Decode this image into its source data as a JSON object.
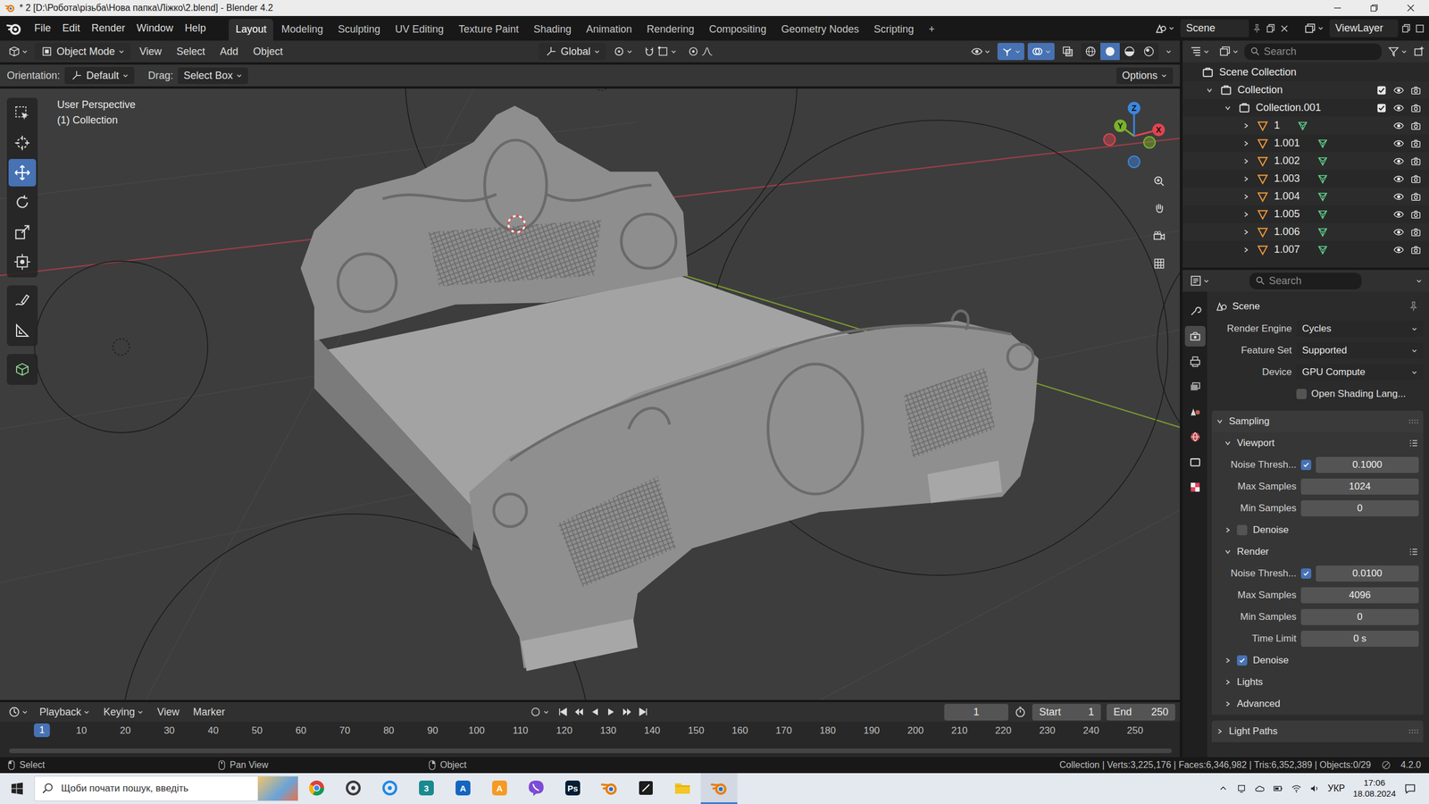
{
  "window": {
    "title": "* 2 [D:\\Робота\\різьба\\Нова папка\\Ліжко\\2.blend] - Blender 4.2"
  },
  "topbar": {
    "menus": [
      "File",
      "Edit",
      "Render",
      "Window",
      "Help"
    ],
    "workspaces": [
      {
        "label": "Layout",
        "selected": true
      },
      {
        "label": "Modeling",
        "selected": false
      },
      {
        "label": "Sculpting",
        "selected": false
      },
      {
        "label": "UV Editing",
        "selected": false
      },
      {
        "label": "Texture Paint",
        "selected": false
      },
      {
        "label": "Shading",
        "selected": false
      },
      {
        "label": "Animation",
        "selected": false
      },
      {
        "label": "Rendering",
        "selected": false
      },
      {
        "label": "Compositing",
        "selected": false
      },
      {
        "label": "Geometry Nodes",
        "selected": false
      },
      {
        "label": "Scripting",
        "selected": false
      }
    ],
    "add_tab": "+",
    "scene": "Scene",
    "view_layer": "ViewLayer"
  },
  "viewport": {
    "header": {
      "mode": "Object Mode",
      "menus": [
        "View",
        "Select",
        "Add",
        "Object"
      ],
      "orientation": "Global",
      "toggles": [
        {
          "kind": "visibility",
          "on": false
        },
        {
          "kind": "gizmos",
          "on": true
        },
        {
          "kind": "overlays",
          "on": true
        },
        {
          "kind": "xray",
          "on": false
        }
      ],
      "shading": [
        {
          "kind": "wireframe",
          "selected": false
        },
        {
          "kind": "solid",
          "selected": true
        },
        {
          "kind": "material",
          "selected": false
        },
        {
          "kind": "rendered",
          "selected": false
        }
      ]
    },
    "tool_settings": {
      "orientation_label": "Orientation:",
      "orientation": "Default",
      "drag_label": "Drag:",
      "drag": "Select Box",
      "options": "Options"
    },
    "overlay_text": [
      "User Perspective",
      "(1) Collection"
    ],
    "tool_groups": [
      [
        {
          "kind": "select",
          "selected": false
        },
        {
          "kind": "cursor",
          "selected": false
        },
        {
          "kind": "move",
          "selected": true
        },
        {
          "kind": "rotate",
          "selected": false
        },
        {
          "kind": "scale",
          "selected": false
        },
        {
          "kind": "transform",
          "selected": false
        }
      ],
      [
        {
          "kind": "annotate",
          "selected": false
        },
        {
          "kind": "measure",
          "selected": false
        }
      ],
      [
        {
          "kind": "add-cube",
          "selected": false
        }
      ]
    ],
    "gizmo_axes": [
      {
        "label": "X",
        "color": "#e0454f"
      },
      {
        "label": "Y",
        "color": "#7bb22a"
      },
      {
        "label": "Z",
        "color": "#3b86e0"
      }
    ]
  },
  "timeline": {
    "menus": [
      "Playback",
      "Keying",
      "View",
      "Marker"
    ],
    "current_frame": "1",
    "start_label": "Start",
    "start": "1",
    "end_label": "End",
    "end": "250",
    "playhead": "1",
    "ticks": [
      "10",
      "20",
      "30",
      "40",
      "50",
      "60",
      "70",
      "80",
      "90",
      "100",
      "110",
      "120",
      "130",
      "140",
      "150",
      "160",
      "170",
      "180",
      "190",
      "200",
      "210",
      "220",
      "230",
      "240",
      "250"
    ]
  },
  "status_bar": {
    "hints": [
      "Select",
      "Pan View",
      "Object"
    ],
    "stats": "Collection | Verts:3,225,176 | Faces:6,346,982 | Tris:6,352,389 | Objects:0/29",
    "version": "4.2.0"
  },
  "outliner": {
    "search": "Search",
    "tree": {
      "label": "Scene Collection",
      "kind": "scene",
      "expanded": true,
      "children": [
        {
          "label": "Collection",
          "kind": "collection",
          "expanded": true,
          "checked": true,
          "visible": true,
          "renderable": true,
          "children": [
            {
              "label": "Collection.001",
              "kind": "collection",
              "expanded": true,
              "checked": true,
              "visible": true,
              "renderable": true,
              "children": [
                {
                  "label": "1",
                  "kind": "object",
                  "expanded": false,
                  "visible": true,
                  "renderable": true
                },
                {
                  "label": "1.001",
                  "kind": "object",
                  "expanded": false,
                  "visible": true,
                  "renderable": true
                },
                {
                  "label": "1.002",
                  "kind": "object",
                  "expanded": false,
                  "visible": true,
                  "renderable": true
                },
                {
                  "label": "1.003",
                  "kind": "object",
                  "expanded": false,
                  "visible": true,
                  "renderable": true
                },
                {
                  "label": "1.004",
                  "kind": "object",
                  "expanded": false,
                  "visible": true,
                  "renderable": true
                },
                {
                  "label": "1.005",
                  "kind": "object",
                  "expanded": false,
                  "visible": true,
                  "renderable": true
                },
                {
                  "label": "1.006",
                  "kind": "object",
                  "expanded": false,
                  "visible": true,
                  "renderable": true
                },
                {
                  "label": "1.007",
                  "kind": "object",
                  "expanded": false,
                  "visible": true,
                  "renderable": true
                }
              ]
            }
          ]
        }
      ]
    }
  },
  "properties": {
    "search": "Search",
    "tabs": [
      {
        "kind": "tool",
        "selected": false
      },
      {
        "kind": "render",
        "selected": true
      },
      {
        "kind": "output",
        "selected": false
      },
      {
        "kind": "view-layer",
        "selected": false
      },
      {
        "kind": "scene",
        "selected": false
      },
      {
        "kind": "world",
        "selected": false
      },
      {
        "kind": "collection",
        "selected": false
      },
      {
        "kind": "texture",
        "selected": false
      }
    ],
    "context": "Scene",
    "rows": [
      {
        "kind": "dropdown",
        "label": "Render Engine",
        "value": "Cycles"
      },
      {
        "kind": "dropdown",
        "label": "Feature Set",
        "value": "Supported"
      },
      {
        "kind": "dropdown",
        "label": "Device",
        "value": "GPU Compute"
      },
      {
        "kind": "checkbox",
        "label": "Open Shading Lang...",
        "checked": false
      },
      {
        "kind": "panel",
        "label": "Sampling",
        "expanded": true
      },
      {
        "kind": "subpanel",
        "label": "Viewport",
        "expanded": true,
        "presets": true
      },
      {
        "kind": "toggle_number",
        "label": "Noise Thresh...",
        "checked": true,
        "value": "0.1000"
      },
      {
        "kind": "number",
        "label": "Max Samples",
        "value": "1024"
      },
      {
        "kind": "number",
        "label": "Min Samples",
        "value": "0"
      },
      {
        "kind": "subpanel_check",
        "label": "Denoise",
        "expanded": false,
        "checked": false
      },
      {
        "kind": "subpanel",
        "label": "Render",
        "expanded": true,
        "presets": true
      },
      {
        "kind": "toggle_number",
        "label": "Noise Thresh...",
        "checked": true,
        "value": "0.0100"
      },
      {
        "kind": "number",
        "label": "Max Samples",
        "value": "4096"
      },
      {
        "kind": "number",
        "label": "Min Samples",
        "value": "0"
      },
      {
        "kind": "number",
        "label": "Time Limit",
        "value": "0 s"
      },
      {
        "kind": "subpanel_check",
        "label": "Denoise",
        "expanded": false,
        "checked": true
      },
      {
        "kind": "subpanel",
        "label": "Lights",
        "expanded": false,
        "presets": false
      },
      {
        "kind": "subpanel",
        "label": "Advanced",
        "expanded": false,
        "presets": false
      },
      {
        "kind": "panel",
        "label": "Light Paths",
        "expanded": false
      }
    ]
  },
  "taskbar": {
    "search": "Щоби почати пошук, введіть",
    "apps": [
      {
        "kind": "chrome",
        "color": "#db4437",
        "active": false
      },
      {
        "kind": "ring",
        "color": "#3a3a3a",
        "active": false
      },
      {
        "kind": "ring",
        "color": "#1e88e5",
        "active": false
      },
      {
        "kind": "letter",
        "label": "3",
        "color": "#1a8a8f",
        "active": false
      },
      {
        "kind": "letter",
        "label": "A",
        "color": "#1565c0",
        "active": false
      },
      {
        "kind": "letter",
        "label": "A",
        "color": "#f59a23",
        "active": false
      },
      {
        "kind": "viber",
        "color": "#7d4bd6",
        "active": false
      },
      {
        "kind": "letter",
        "label": "Ps",
        "color": "#001e36",
        "active": false
      },
      {
        "kind": "blender",
        "color": "#e87d0d",
        "active": false
      },
      {
        "kind": "tile",
        "color": "#1c1c1c",
        "active": false
      },
      {
        "kind": "folder",
        "color": "#f3c623",
        "active": false
      },
      {
        "kind": "blender",
        "color": "#e87d0d",
        "active": true
      }
    ],
    "tray": {
      "language": "УКР",
      "time": "17:06",
      "date": "18.08.2024"
    }
  }
}
